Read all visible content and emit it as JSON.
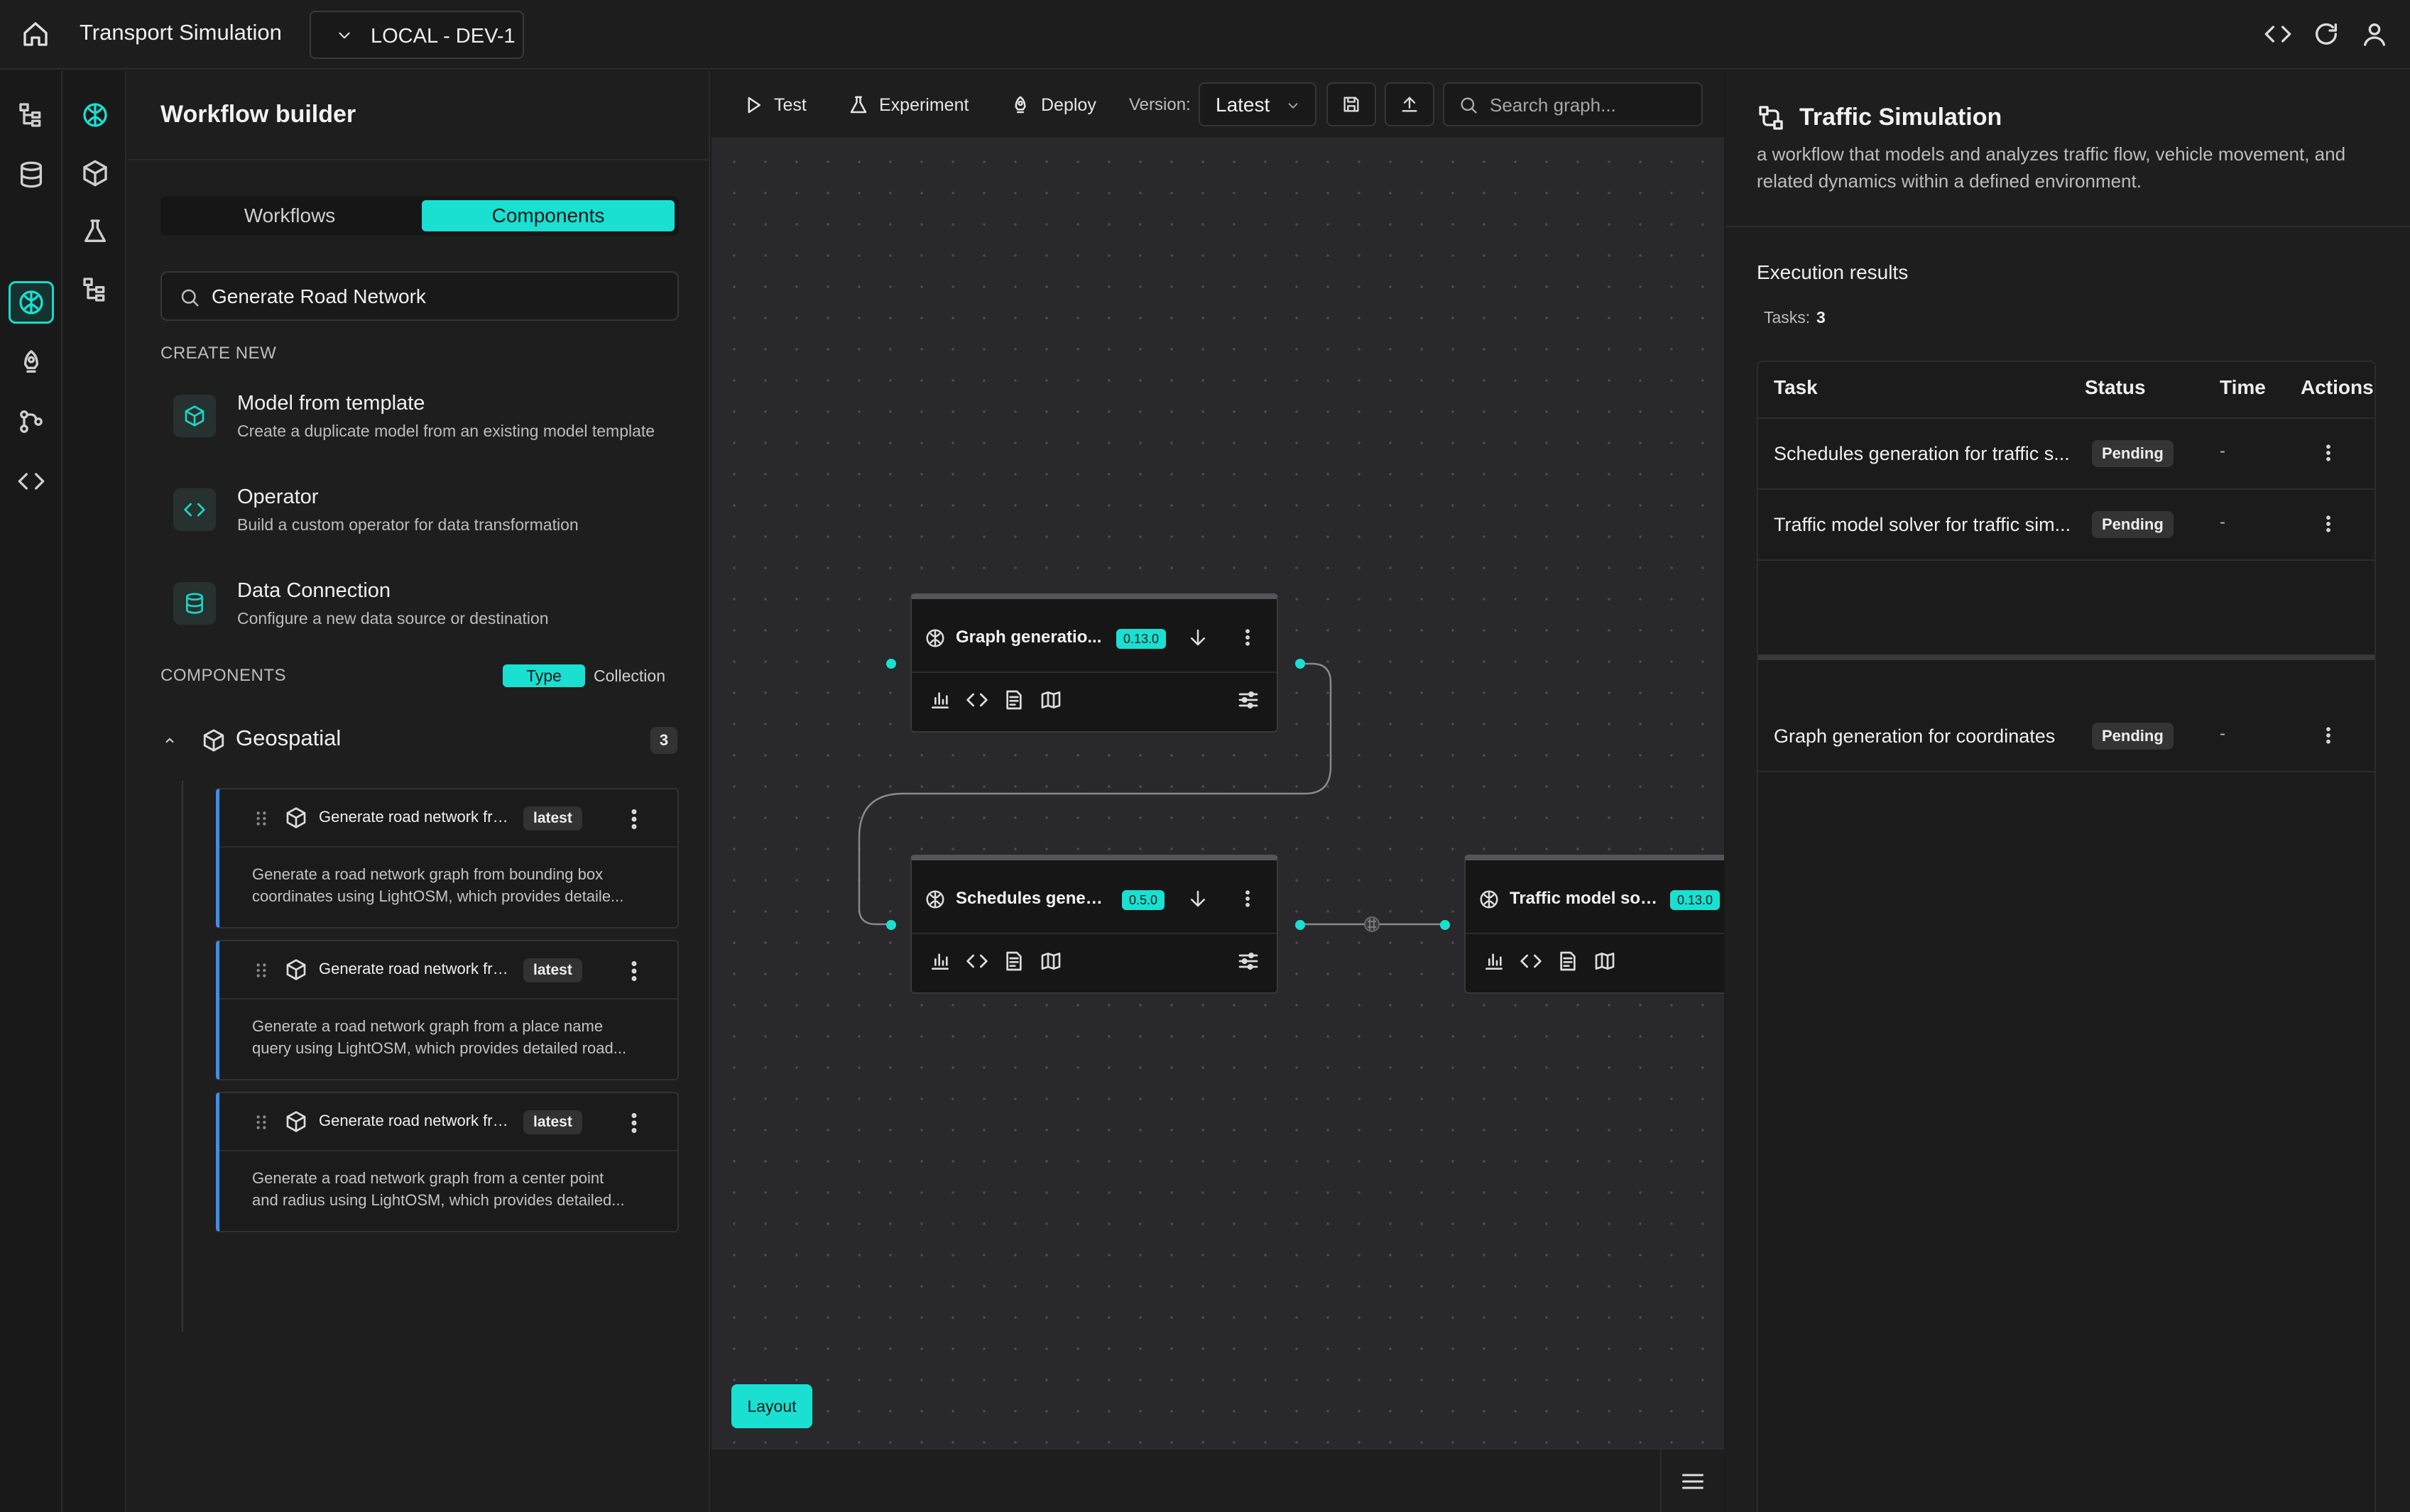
{
  "app": {
    "title": "Transport Simulation",
    "environment": "LOCAL - DEV-1"
  },
  "sidepanel": {
    "title": "Workflow builder",
    "tabs": [
      {
        "label": "Workflows",
        "active": false
      },
      {
        "label": "Components",
        "active": true
      }
    ],
    "search_value": "Generate Road Network",
    "create_new_heading": "CREATE NEW",
    "create_items": [
      {
        "title": "Model from template",
        "description": "Create a duplicate model from an existing model template",
        "icon": "cube-icon"
      },
      {
        "title": "Operator",
        "description": "Build a custom operator for data transformation",
        "icon": "code-icon"
      },
      {
        "title": "Data Connection",
        "description": "Configure a new data source or destination",
        "icon": "database-icon"
      }
    ],
    "components_heading": "COMPONENTS",
    "filter": {
      "type_label": "Type",
      "collection_label": "Collection",
      "active": "Type"
    },
    "group": {
      "label": "Geospatial",
      "count": "3"
    },
    "components": [
      {
        "title": "Generate road network fro...",
        "badge": "latest",
        "desc_line1": "Generate a road network graph from bounding box",
        "desc_line2": "coordinates using LightOSM, which provides detaile..."
      },
      {
        "title": "Generate road network fro...",
        "badge": "latest",
        "desc_line1": "Generate a road network graph from a place name",
        "desc_line2": "query using LightOSM, which provides detailed road..."
      },
      {
        "title": "Generate road network fro...",
        "badge": "latest",
        "desc_line1": "Generate a road network graph from a center point",
        "desc_line2": "and radius using LightOSM, which provides detailed..."
      }
    ]
  },
  "toolbar": {
    "test_label": "Test",
    "experiment_label": "Experiment",
    "deploy_label": "Deploy",
    "version_label": "Version:",
    "version_value": "Latest",
    "search_placeholder": "Search graph..."
  },
  "nodes": [
    {
      "title": "Graph generatio...",
      "version": "0.13.0"
    },
    {
      "title": "Schedules gener...",
      "version": "0.5.0"
    },
    {
      "title": "Traffic model sol...",
      "version": "0.13.0"
    }
  ],
  "canvas": {
    "layout_label": "Layout"
  },
  "rightpanel": {
    "title": "Traffic Simulation",
    "description": "a workflow that models and analyzes traffic flow, vehicle movement, and related dynamics within a defined environment.",
    "execution_title": "Execution results",
    "tasks_label": "Tasks:",
    "tasks_count": "3",
    "columns": [
      "Task",
      "Status",
      "Time",
      "Actions"
    ],
    "rows": [
      {
        "task": "Schedules generation for traffic s...",
        "status": "Pending",
        "time": "-"
      },
      {
        "task": "Traffic model solver for traffic sim...",
        "status": "Pending",
        "time": "-"
      },
      {
        "task": "Graph generation for coordinates",
        "status": "Pending",
        "time": "-"
      }
    ]
  },
  "colors": {
    "accent": "#19e0d1",
    "background": "#1c1b1c",
    "canvas": "#29282a",
    "card_border": "#3a8ff0"
  }
}
